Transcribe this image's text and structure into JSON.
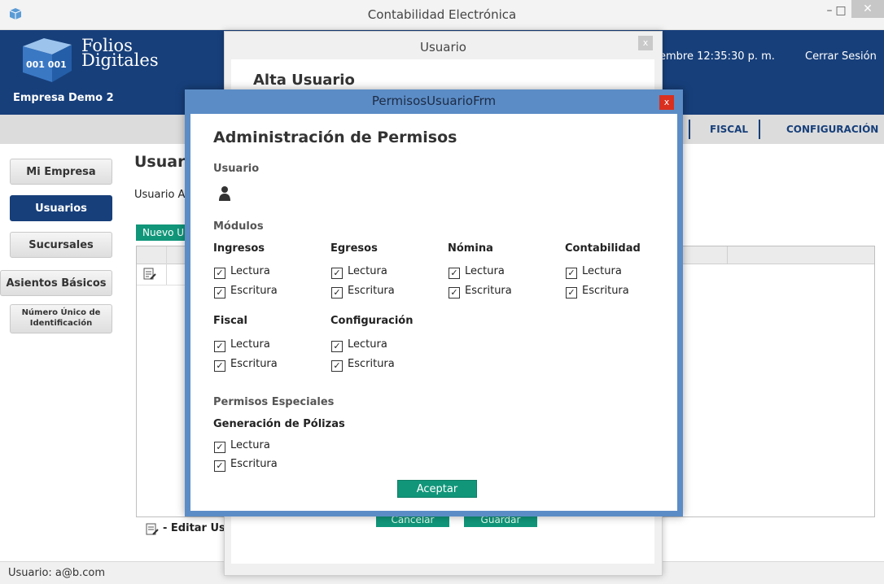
{
  "window": {
    "title": "Contabilidad Electrónica",
    "minimize": "–",
    "maximize": "□",
    "close": "✕"
  },
  "header": {
    "logo_line1": "Folios",
    "logo_line2": "Digitales",
    "logo_cube_text": "001 001",
    "empresa": "Empresa Demo 2",
    "datetime": "embre 12:35:30 p. m.",
    "logout": "Cerrar Sesión"
  },
  "nav": {
    "fiscal": "FISCAL",
    "configuracion": "CONFIGURACIÓN"
  },
  "sidebar": {
    "items": [
      {
        "label": "Mi Empresa"
      },
      {
        "label": "Usuarios"
      },
      {
        "label": "Sucursales"
      },
      {
        "label": "Asientos Básicos"
      },
      {
        "label": "Número Único de Identificación"
      }
    ]
  },
  "main": {
    "title": "Usuari",
    "subtitle": "Usuario Ac",
    "new_button": "Nuevo U",
    "edit_legend": "- Editar Usu"
  },
  "footer": {
    "user": "Usuario: a@b.com"
  },
  "usuario_dialog": {
    "title": "Usuario",
    "close": "x",
    "heading": "Alta Usuario",
    "cancel": "Cancelar",
    "save": "Guardar"
  },
  "permisos_dialog": {
    "title": "PermisosUsuarioFrm",
    "close": "x",
    "heading": "Administración de Permisos",
    "usuario_label": "Usuario",
    "modulos_label": "Módulos",
    "modules": [
      {
        "name": "Ingresos",
        "read": "Lectura",
        "write": "Escritura",
        "read_checked": true,
        "write_checked": true
      },
      {
        "name": "Egresos",
        "read": "Lectura",
        "write": "Escritura",
        "read_checked": true,
        "write_checked": true
      },
      {
        "name": "Nómina",
        "read": "Lectura",
        "write": "Escritura",
        "read_checked": true,
        "write_checked": true
      },
      {
        "name": "Contabilidad",
        "read": "Lectura",
        "write": "Escritura",
        "read_checked": true,
        "write_checked": true
      },
      {
        "name": "Fiscal",
        "read": "Lectura",
        "write": "Escritura",
        "read_checked": true,
        "write_checked": true
      },
      {
        "name": "Configuración",
        "read": "Lectura",
        "write": "Escritura",
        "read_checked": true,
        "write_checked": true
      }
    ],
    "especiales_label": "Permisos Especiales",
    "polizas": {
      "name": "Generación de Pólizas",
      "read": "Lectura",
      "write": "Escritura",
      "read_checked": true,
      "write_checked": true
    },
    "accept": "Aceptar"
  },
  "colors": {
    "header": "#173f7a",
    "accent": "#11967a",
    "dialog_frame": "#5b8cc6",
    "close_red": "#d9301f"
  }
}
